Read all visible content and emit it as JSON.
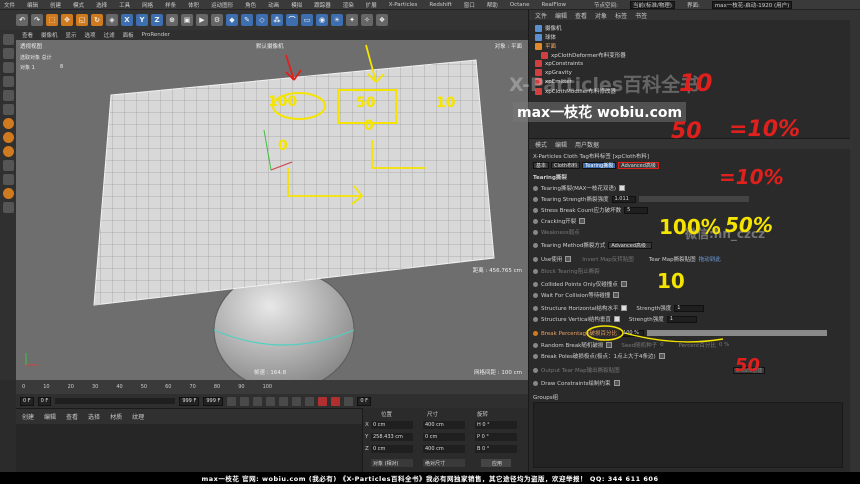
{
  "menubar": {
    "items": [
      "文件",
      "编辑",
      "创建",
      "模式",
      "选择",
      "工具",
      "网格",
      "样条",
      "体积",
      "运动图形",
      "角色",
      "动画",
      "模拟",
      "跟踪器",
      "渲染",
      "扩展",
      "X-Particles",
      "Redshift",
      "窗口",
      "帮助",
      "Octane",
      "RealFlow"
    ],
    "layout_label": "节点空间:",
    "layout_value": "当前(标准/物理)",
    "interface_label": "界面:",
    "interface_value": "max一枝花-启动-1920 (用户)"
  },
  "viewport": {
    "menu": [
      "查看",
      "摄像机",
      "显示",
      "选项",
      "过滤",
      "面板",
      "ProRender"
    ],
    "label": "透视视图",
    "camera": "默认摄像机",
    "selection_label": "选取对象 总计",
    "object_count_label": "对象 1",
    "object_count_value": "8",
    "object_plane": "对象 : 平面",
    "distance": "距离 : 456.765 cm",
    "speed": "帧速 : 164.8",
    "grid_spacing": "网格间距 : 100 cm"
  },
  "timeline": {
    "ticks": [
      "0",
      "10",
      "20",
      "30",
      "40",
      "50",
      "60",
      "70",
      "80",
      "90",
      "100"
    ],
    "frame_start": "0 F",
    "frame_cur": "0 F",
    "frame_end": "999 F",
    "frame_end2": "999 F",
    "frame_end_right": "0 F"
  },
  "material_panel": {
    "menu": [
      "创建",
      "编辑",
      "查看",
      "选择",
      "材质",
      "纹理"
    ]
  },
  "coord_panel": {
    "headers": [
      "位置",
      "尺寸",
      "旋转"
    ],
    "rows": [
      {
        "axis": "X",
        "pos": "0 cm",
        "size": "400 cm",
        "rot": "H 0 °"
      },
      {
        "axis": "Y",
        "pos": "258.433 cm",
        "size": "0 cm",
        "rot": "P 0 °"
      },
      {
        "axis": "Z",
        "pos": "0 cm",
        "size": "400 cm",
        "rot": "B 0 °"
      }
    ],
    "mode_object": "对象 (相对)",
    "mode_size": "绝对尺寸",
    "apply": "应用"
  },
  "object_manager": {
    "menu": [
      "文件",
      "编辑",
      "查看",
      "对象",
      "标签",
      "书签"
    ],
    "items": [
      {
        "name": "摄像机",
        "color": "#5a8fd0"
      },
      {
        "name": "球体",
        "color": "#5a8fd0"
      },
      {
        "name": "平面",
        "color": "#e08a2e"
      },
      {
        "name": "xpClothDeformer布料变形器",
        "color": "#d04040"
      },
      {
        "name": "xpConstraints",
        "color": "#d04040"
      },
      {
        "name": "xpGravity",
        "color": "#d04040"
      },
      {
        "name": "xpEmitter",
        "color": "#d04040"
      },
      {
        "name": "xpClothModifier布料修改器",
        "color": "#d04040"
      }
    ]
  },
  "attributes": {
    "menu": [
      "模式",
      "编辑",
      "用户数据"
    ],
    "tag_title": "X-Particles Cloth Tag布料标签 [xpCloth布料]",
    "tabs": [
      "基本",
      "Cloth布料",
      "Tearing撕裂",
      "Advanced高级"
    ],
    "section": "Tearing撕裂",
    "rows": {
      "tearing": "Tearing撕裂(MAX一枝花双语)",
      "strength": "Tearing Strength撕裂强度",
      "strength_val": "1.011",
      "stress": "Stress Break Count应力破坏数",
      "stress_val": "5",
      "cracking": "Cracking开裂",
      "weakness": "Weakness弱点",
      "method": "Tearing Method撕裂方式",
      "method_val": "Advanced高级",
      "use_map": "Use使用",
      "invert_map": "Invert Map反转贴图",
      "tear_map": "Tear Map撕裂贴图",
      "tear_map_val": "拖动到此",
      "block": "Block Tearing阻止撕裂",
      "collided": "Collided Points Only仅碰撞点",
      "wait": "Wait For Collision等待碰撞",
      "horizontal": "Structure Horizontal结构水平",
      "vertical": "Structure Vertical结构垂直",
      "strength_label": "Strength强度",
      "strength_h": "1",
      "strength_v": "1",
      "break_pct": "Break Percentage破损百分比",
      "break_pct_val": "100 %",
      "random_break": "Random Break随机破损",
      "seed": "Seed随机种子",
      "seed_val": "0",
      "percent": "Percent百分比",
      "percent_val": "0 %",
      "break_poles": "Break Poles破损极点(极点：1点上大于4条边)",
      "output_map": "Output Tear Map输出撕裂贴图",
      "create": "Create创建",
      "draw": "Draw Constraints绘制约束",
      "groups": "Groups组"
    }
  },
  "watermarks": {
    "title": "X-Particles百科全书",
    "site": "max一枝花 wobiu.com",
    "wechat": "微信:hn_czcz"
  },
  "annotations": [
    "100",
    "50",
    "10",
    "0",
    "0",
    "10",
    "50",
    "=10%",
    "=10%",
    "50%",
    "100%",
    "10",
    "50",
    "10%"
  ],
  "footer": "max一枝花 官网: wobiu.com (我必有)   《X-Particles百科全书》我必有网独家销售，其它途径均为盗版，欢迎举报！  QQ: 344 611 606",
  "colors": {
    "accent": "#d07a1f",
    "highlight_yellow": "#f5e400",
    "annotation_red": "#e0201c",
    "selected_blue": "#3d6fb0"
  }
}
